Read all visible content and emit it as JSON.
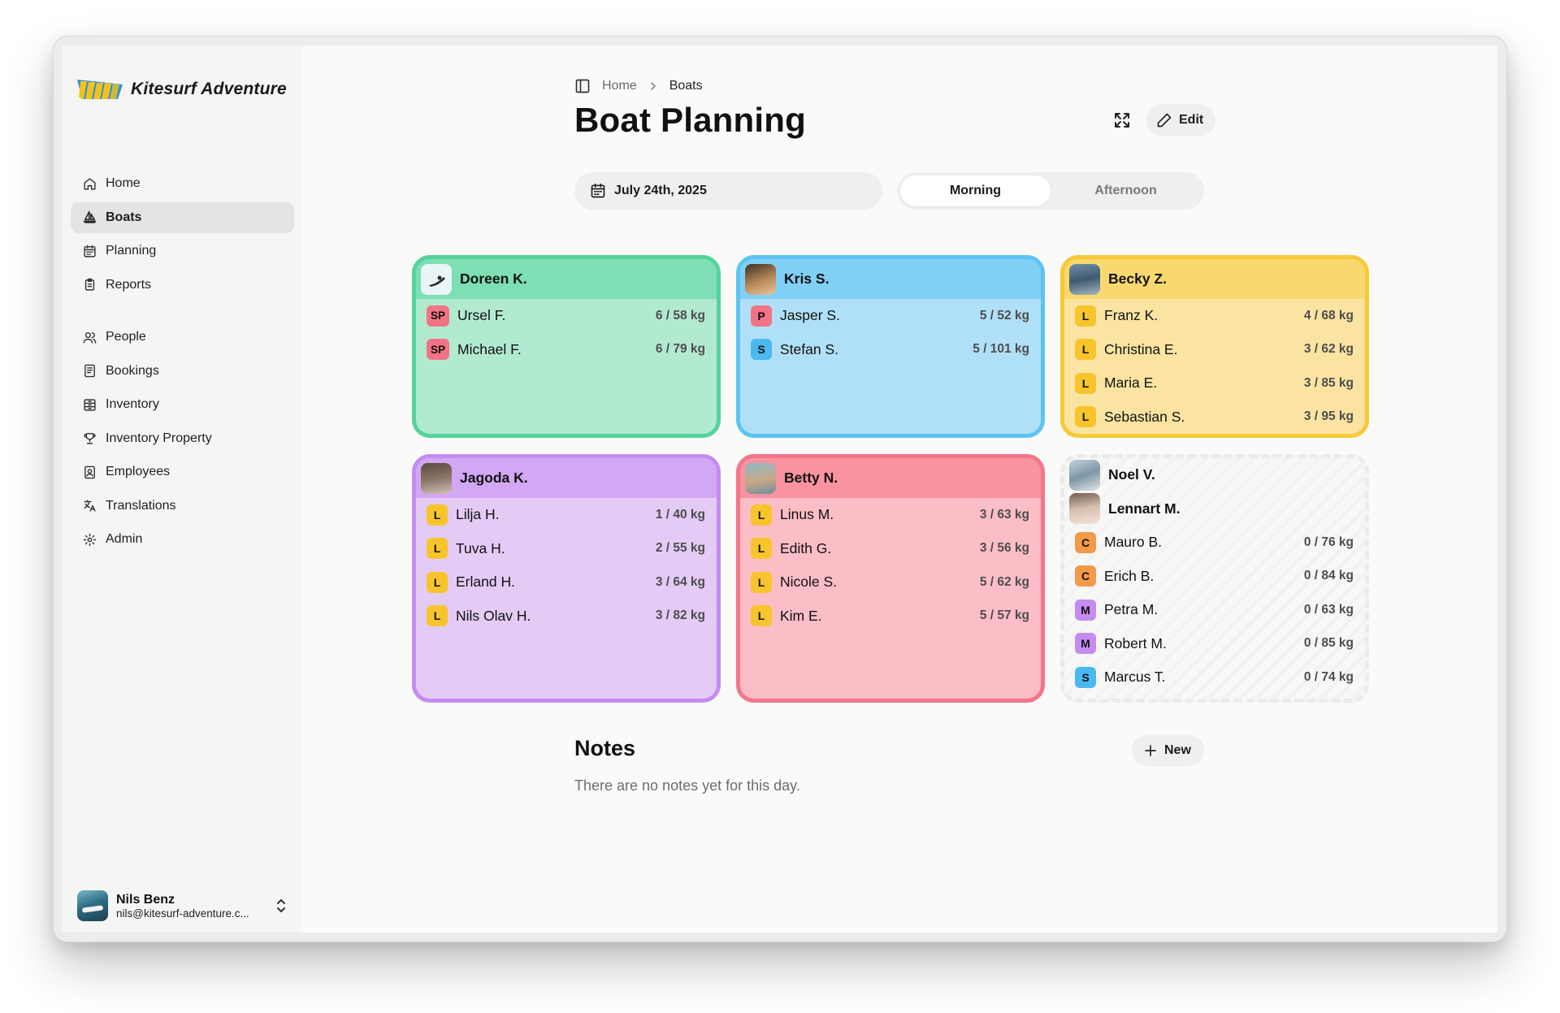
{
  "app": {
    "name": "Kitesurf Adventure"
  },
  "sidebar": {
    "items": [
      {
        "label": "Home",
        "icon": "home-icon"
      },
      {
        "label": "Boats",
        "icon": "sailboat-icon",
        "active": true
      },
      {
        "label": "Planning",
        "icon": "calendar-icon"
      },
      {
        "label": "Reports",
        "icon": "clipboard-icon"
      },
      {
        "label": "People",
        "icon": "users-icon"
      },
      {
        "label": "Bookings",
        "icon": "book-icon"
      },
      {
        "label": "Inventory",
        "icon": "archive-icon"
      },
      {
        "label": "Inventory Property",
        "icon": "trophy-icon"
      },
      {
        "label": "Employees",
        "icon": "badge-icon"
      },
      {
        "label": "Translations",
        "icon": "languages-icon"
      },
      {
        "label": "Admin",
        "icon": "gear-icon"
      }
    ]
  },
  "user": {
    "name": "Nils Benz",
    "email": "nils@kitesurf-adventure.c..."
  },
  "breadcrumb": {
    "home": "Home",
    "current": "Boats"
  },
  "page": {
    "title": "Boat Planning",
    "edit_label": "Edit"
  },
  "filters": {
    "date": "July 24th, 2025",
    "morning": "Morning",
    "afternoon": "Afternoon"
  },
  "boats": [
    {
      "instructor": "Doreen K.",
      "color": "#55d39b",
      "riders": [
        {
          "level": "SP",
          "name": "Ursel F.",
          "value": "6 / 58 kg"
        },
        {
          "level": "SP",
          "name": "Michael F.",
          "value": "6 / 79 kg"
        }
      ]
    },
    {
      "instructor": "Kris S.",
      "color": "#5cc4f3",
      "riders": [
        {
          "level": "P",
          "name": "Jasper S.",
          "value": "5 / 52 kg"
        },
        {
          "level": "S",
          "name": "Stefan S.",
          "value": "5 / 101 kg"
        }
      ]
    },
    {
      "instructor": "Becky Z.",
      "color": "#f6c937",
      "riders": [
        {
          "level": "L",
          "name": "Franz K.",
          "value": "4 / 68 kg"
        },
        {
          "level": "L",
          "name": "Christina E.",
          "value": "3 / 62 kg"
        },
        {
          "level": "L",
          "name": "Maria E.",
          "value": "3 / 85 kg"
        },
        {
          "level": "L",
          "name": "Sebastian S.",
          "value": "3 / 95 kg"
        }
      ]
    },
    {
      "instructor": "Jagoda K.",
      "color": "#c48cf0",
      "riders": [
        {
          "level": "L",
          "name": "Lilja H.",
          "value": "1 / 40 kg"
        },
        {
          "level": "L",
          "name": "Tuva H.",
          "value": "2 / 55 kg"
        },
        {
          "level": "L",
          "name": "Erland H.",
          "value": "3 / 64 kg"
        },
        {
          "level": "L",
          "name": "Nils Olav H.",
          "value": "3 / 82 kg"
        }
      ]
    },
    {
      "instructor": "Betty N.",
      "color": "#f47589",
      "riders": [
        {
          "level": "L",
          "name": "Linus M.",
          "value": "3 / 63 kg"
        },
        {
          "level": "L",
          "name": "Edith G.",
          "value": "3 / 56 kg"
        },
        {
          "level": "L",
          "name": "Nicole S.",
          "value": "5 / 62 kg"
        },
        {
          "level": "L",
          "name": "Kim E.",
          "value": "5 / 57 kg"
        }
      ]
    },
    {
      "instructor": "Noel V.",
      "instructor2": "Lennart M.",
      "riders": [
        {
          "level": "C",
          "name": "Mauro B.",
          "value": "0 / 76 kg"
        },
        {
          "level": "C",
          "name": "Erich B.",
          "value": "0 / 84 kg"
        },
        {
          "level": "M",
          "name": "Petra M.",
          "value": "0 / 63 kg"
        },
        {
          "level": "M",
          "name": "Robert M.",
          "value": "0 / 85 kg"
        },
        {
          "level": "S",
          "name": "Marcus T.",
          "value": "0 / 74 kg"
        }
      ]
    }
  ],
  "notes": {
    "title": "Notes",
    "new_label": "New",
    "empty": "There are no notes yet for this day."
  }
}
